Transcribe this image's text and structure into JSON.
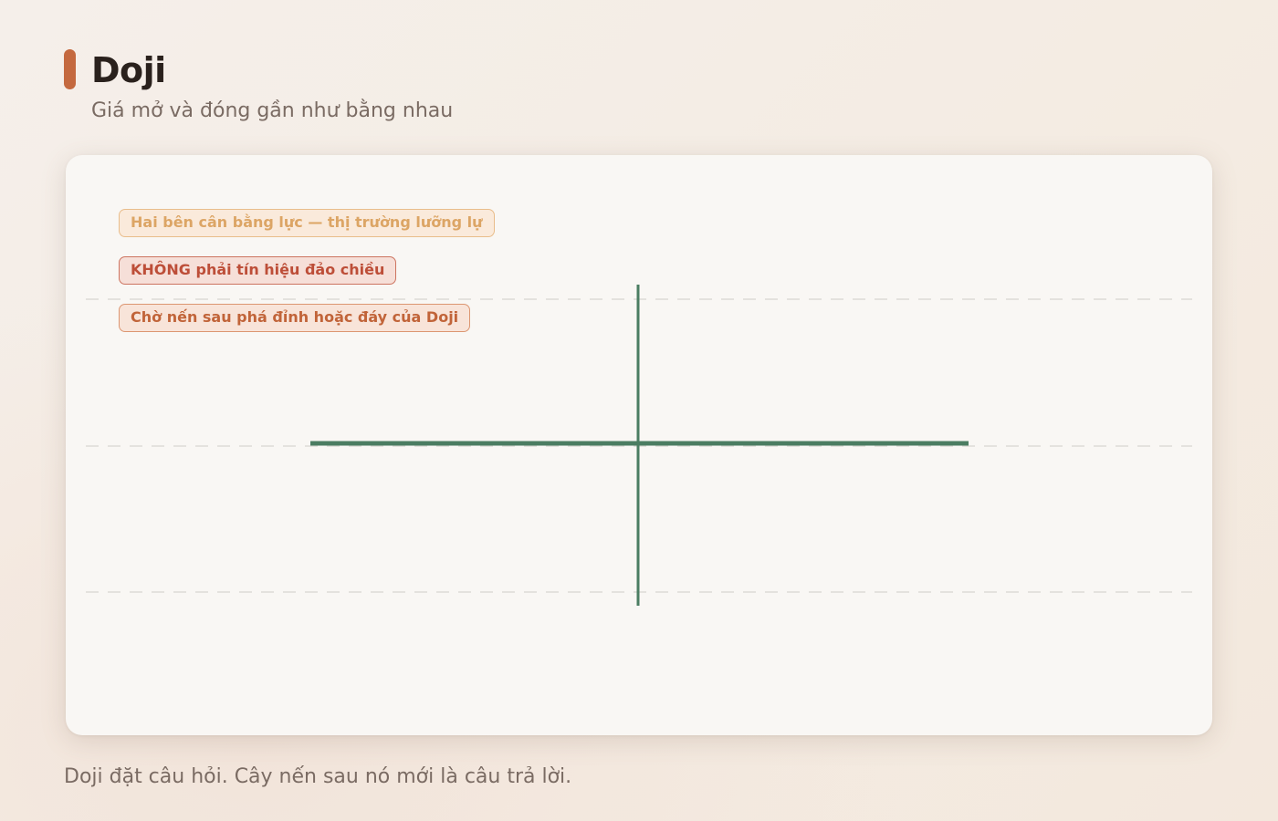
{
  "header": {
    "title": "Doji",
    "subtitle": "Giá mở và đóng gần như bằng nhau"
  },
  "tags": [
    {
      "label": "Hai bên cân bằng lực — thị trường lưỡng lự",
      "color": "#dca565"
    },
    {
      "label": "KHÔNG phải tín hiệu đảo chiều",
      "color": "#bd4e38"
    },
    {
      "label": "Chờ nến sau phá đỉnh hoặc đáy của Doji",
      "color": "#c16439"
    }
  ],
  "diagram": {
    "candle": {
      "type": "doji",
      "color": "#4b7d62"
    },
    "gridline_color": "#dedbd6",
    "gridline_style": "dashed"
  },
  "caption": "Doji đặt câu hỏi. Cây nến sau nó mới là câu trả lời.",
  "colors": {
    "accent": "#c4693f",
    "card_background": "#f9f7f4",
    "title": "#2a211d",
    "muted_text": "#7a6b63"
  }
}
